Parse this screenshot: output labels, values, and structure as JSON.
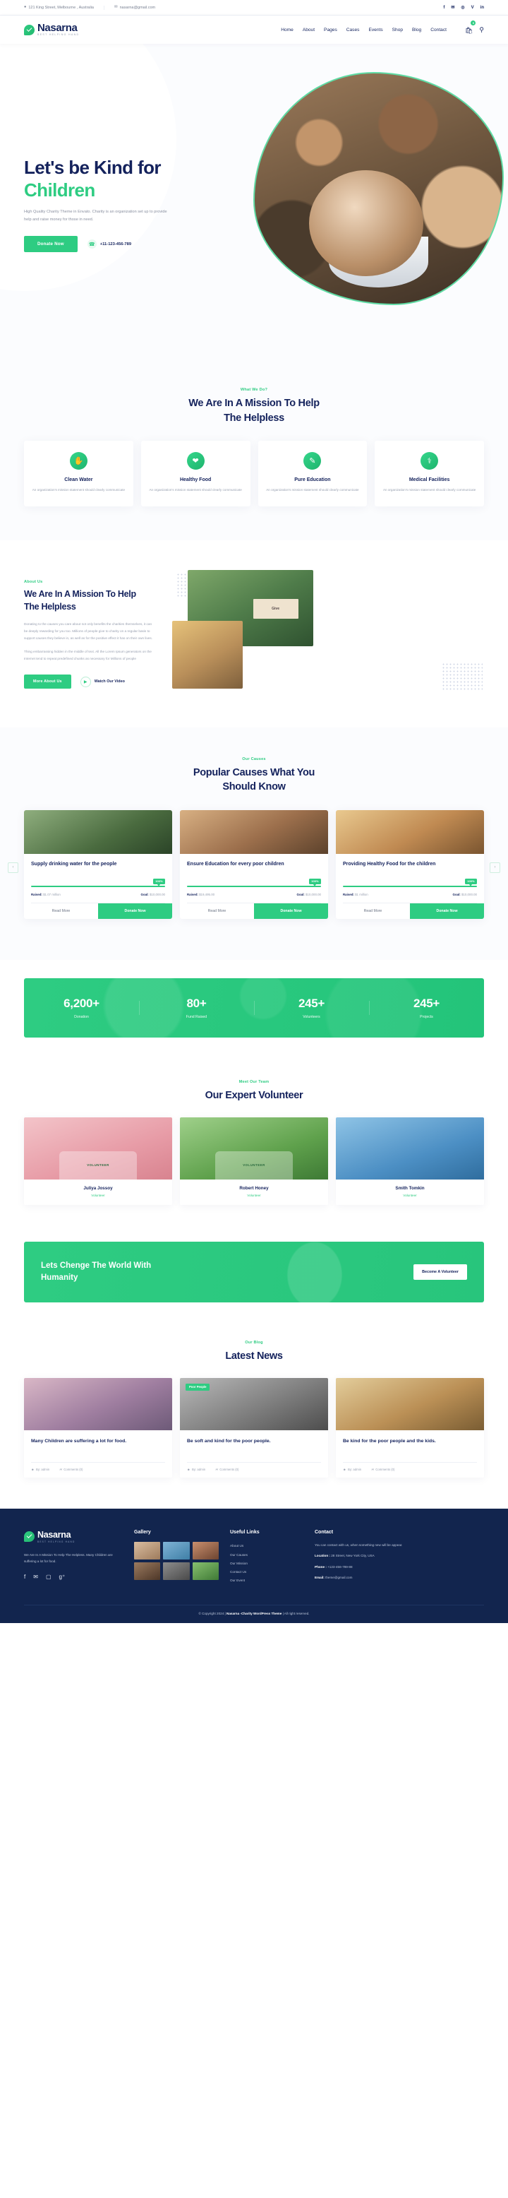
{
  "topbar": {
    "address": "121 King Street, Melbourne , Australia",
    "email": "nasarna@gmail.com",
    "address_icon": "map-pin-icon",
    "email_icon": "envelope-icon",
    "social": [
      {
        "name": "facebook-icon",
        "glyph": "f"
      },
      {
        "name": "twitter-icon",
        "glyph": "✉"
      },
      {
        "name": "instagram-icon",
        "glyph": "◎"
      },
      {
        "name": "vimeo-icon",
        "glyph": "V"
      },
      {
        "name": "linkedin-icon",
        "glyph": "in"
      }
    ]
  },
  "header": {
    "brand_name": "Nasarna",
    "brand_tagline": "BEST HELPING HAND",
    "nav": [
      {
        "label": "Home"
      },
      {
        "label": "About"
      },
      {
        "label": "Pages"
      },
      {
        "label": "Cases"
      },
      {
        "label": "Events"
      },
      {
        "label": "Shop"
      },
      {
        "label": "Blog"
      },
      {
        "label": "Contact"
      }
    ],
    "cart_count": "0",
    "cart_icon": "shopping-bag-icon",
    "search_icon": "search-icon"
  },
  "hero": {
    "title_line1": "Let's be Kind for",
    "title_line2": "Children",
    "paragraph": "High Quality Charity Theme in Envato. Charity is an organization set up to provide help and raise money for those in need.",
    "cta_label": "Donate Now",
    "phone": "+11-123-456-789",
    "phone_icon": "headset-icon"
  },
  "services": {
    "eyebrow": "What We Do?",
    "title_line1": "We Are In A Mission To Help",
    "title_line2": "The Helpless",
    "cards": [
      {
        "icon": "hand-water-drop-icon",
        "glyph": "✋",
        "title": "Clean Water",
        "text": "An organization's mission statement should clearly communicate"
      },
      {
        "icon": "healthy-food-icon",
        "glyph": "❤",
        "title": "Healthy Food",
        "text": "An organization's mission statement should clearly communicate"
      },
      {
        "icon": "education-book-icon",
        "glyph": "✎",
        "title": "Pure Education",
        "text": "An organization's mission statement should clearly communicate"
      },
      {
        "icon": "medical-heart-icon",
        "glyph": "⚕",
        "title": "Medical Facilities",
        "text": "An organization's mission statement should clearly communicate"
      }
    ]
  },
  "about": {
    "eyebrow": "About Us",
    "title_line1": "We Are In A Mission To Help",
    "title_line2": "The Helpless",
    "paragraph1": "Donating to the causes you care about not only benefits the charities themselves, it can be deeply rewarding for you too. Millions of people give to charity on a regular basis to support causes they believe in, as well as for the positive effect it has on their own lives.",
    "paragraph2": "Thing embarrassing hidden in the middle of text. All the Lorem Ipsum generators on the Internet tend to repeat predefined chunks as necessary for Millions of people",
    "button_label": "More About Us",
    "video_label": "Watch Our Video",
    "play_icon": "play-icon",
    "sign_text": "Give"
  },
  "causes": {
    "eyebrow": "Our Causes",
    "title_line1": "Popular Causes What You",
    "title_line2": "Should Know",
    "prev_icon": "chevron-left-icon",
    "next_icon": "chevron-right-icon",
    "read_more_label": "Read More",
    "donate_label": "Donate Now",
    "raised_label": "Raised:",
    "goal_label": "Goal:",
    "items": [
      {
        "title": "Supply drinking water for the people",
        "percent": "100%",
        "percent_value": 100,
        "raised": "$1.07 million",
        "goal": "$10,000.00"
      },
      {
        "title": "Ensure Education for every poor children",
        "percent": "100%",
        "percent_value": 100,
        "raised": "$19,495.00",
        "goal": "$10,000.00"
      },
      {
        "title": "Providing Healthy Food for the children",
        "percent": "100%",
        "percent_value": 100,
        "raised": "$1 million",
        "goal": "$10,000.00"
      }
    ]
  },
  "stats": [
    {
      "number": "6,200+",
      "label": "Donation"
    },
    {
      "number": "80+",
      "label": "Fund Raised"
    },
    {
      "number": "245+",
      "label": "Volunteers"
    },
    {
      "number": "245+",
      "label": "Projects"
    }
  ],
  "team": {
    "eyebrow": "Meet Our Team",
    "title": "Our Expert Volunteer",
    "members": [
      {
        "name": "Juliya Jossoy",
        "role": "Volunteer",
        "vest": "VOLUNTEER"
      },
      {
        "name": "Robert Honey",
        "role": "Volunteer",
        "vest": "VOLUNTEER"
      },
      {
        "name": "Smith Tomkin",
        "role": "Volunteer",
        "vest": ""
      }
    ]
  },
  "cta": {
    "line1": "Lets Chenge The World With",
    "line2": "Humanity",
    "button_label": "Become A Volunteer"
  },
  "blog": {
    "eyebrow": "Our Blog",
    "title": "Latest News",
    "posts": [
      {
        "title": "Many Children are suffering a lot for food.",
        "tag": "",
        "author": "By: admin",
        "comments": "Comments (0)"
      },
      {
        "title": "Be soft and kind for the poor people.",
        "tag": "Poor People",
        "author": "By: admin",
        "comments": "Comments (0)"
      },
      {
        "title": "Be kind for the poor people and the kids.",
        "tag": "",
        "author": "By: admin",
        "comments": "Comments (0)"
      }
    ],
    "author_icon": "user-icon",
    "comment_icon": "comment-icon"
  },
  "footer": {
    "brand_name": "Nasarna",
    "brand_tagline": "BEST HELPING HAND",
    "about": "We Are In A Mission To Help The Helpless. Many Children are suffering a lot for food.",
    "social": [
      {
        "name": "facebook-icon",
        "glyph": "f"
      },
      {
        "name": "twitter-icon",
        "glyph": "✉"
      },
      {
        "name": "instagram-icon",
        "glyph": "▢"
      },
      {
        "name": "google-plus-icon",
        "glyph": "g⁺"
      }
    ],
    "gallery_head": "Gallery",
    "links_head": "Useful Links",
    "links": [
      "About Us",
      "Our Causes",
      "Our Mission",
      "Contact Us",
      "Our Event"
    ],
    "contact_head": "Contact",
    "contact_intro": "You can contact with us, when something new will be appear.",
    "location_label": "Location :",
    "location_value": " 28 Street, New York City, USA",
    "phone_label": "Phone :",
    "phone_value": " +123-456-789-88",
    "email_label": "Email:",
    "email_value": " theme@gmail.com",
    "copyright_pre": "© Copyright 2024 | ",
    "copyright_strong": "Nasarna -Charity WordPress Theme",
    "copyright_post": " | All right reserved."
  }
}
